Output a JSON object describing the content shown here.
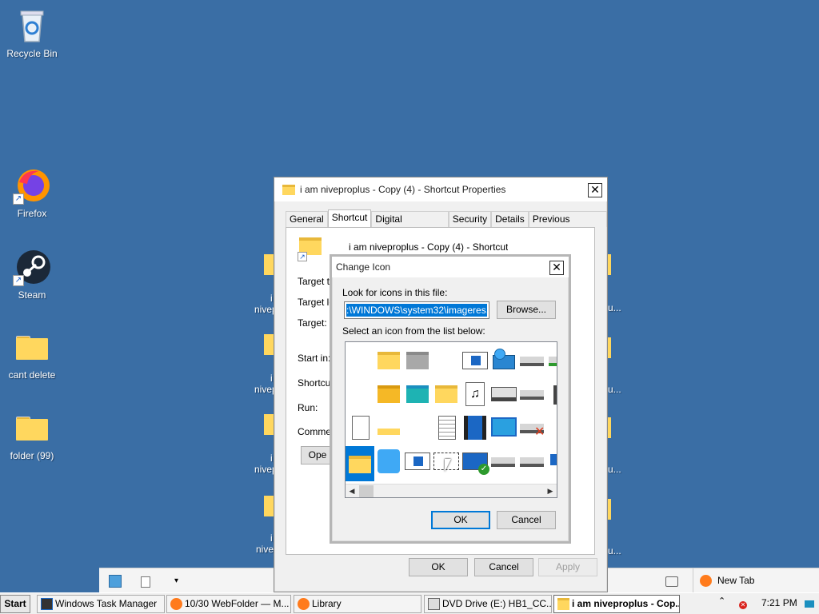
{
  "desktop": {
    "icons": [
      {
        "label": "Recycle Bin"
      },
      {
        "label": "Firefox"
      },
      {
        "label": "Steam"
      },
      {
        "label": "cant delete"
      },
      {
        "label": "folder (99)"
      }
    ],
    "bg_fragments": [
      "i",
      "nivep",
      "i",
      "nivep",
      "i",
      "nivep",
      "i",
      "nive",
      "u...",
      "u...",
      "u...",
      "u..."
    ]
  },
  "properties_dialog": {
    "title": "i am niveproplus - Copy (4) - Shortcut Properties",
    "tabs": [
      "General",
      "Shortcut",
      "Digital Signatures",
      "Security",
      "Details",
      "Previous Versions"
    ],
    "active_tab": "Shortcut",
    "shortcut_name": "i am niveproplus - Copy (4) - Shortcut",
    "field_labels": [
      "Target ty",
      "Target lo",
      "Target:",
      "Start in:",
      "Shortcut",
      "Run:",
      "Commer"
    ],
    "open_button": "Ope",
    "buttons": {
      "ok": "OK",
      "cancel": "Cancel",
      "apply": "Apply"
    }
  },
  "change_icon_dialog": {
    "title": "Change Icon",
    "file_label": "Look for icons in this file:",
    "file_value": ":\\WINDOWS\\system32\\imageres.dll",
    "browse_button": "Browse...",
    "list_label": "Select an icon from the list below:",
    "buttons": {
      "ok": "OK",
      "cancel": "Cancel"
    }
  },
  "strip": {
    "new_tab": "New Tab"
  },
  "taskbar": {
    "start": "Start",
    "items": [
      {
        "label": "Windows Task Manager"
      },
      {
        "label": "10/30 WebFolder — M..."
      },
      {
        "label": "Library"
      },
      {
        "label": "DVD Drive (E:) HB1_CC..."
      },
      {
        "label": "i am niveproplus - Cop..."
      }
    ],
    "clock": "7:21 PM"
  },
  "colors": {
    "desktop": "#3a6ea5",
    "selection": "#0078d7",
    "folder": "#ffd75e"
  }
}
